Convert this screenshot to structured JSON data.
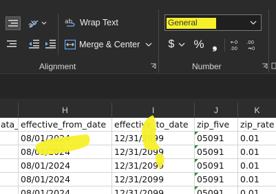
{
  "ribbon": {
    "wrap_text_label": "Wrap Text",
    "merge_center_label": "Merge & Center",
    "number_format_value": "General",
    "currency_symbol": "$",
    "percent_symbol": "%",
    "comma_symbol": "❟",
    "alignment_group_label": "Alignment",
    "number_group_label": "Number",
    "highlight_color": "#f6f02a"
  },
  "columns": [
    {
      "letter": "",
      "header": "ata_"
    },
    {
      "letter": "H",
      "header": "effective_from_date"
    },
    {
      "letter": "I",
      "header": "effective_to_date"
    },
    {
      "letter": "J",
      "header": "zip_five"
    },
    {
      "letter": "K",
      "header": "zip_rate"
    }
  ],
  "rows": [
    {
      "from": "08/01/2024",
      "to": "12/31/2099",
      "zip": "05091",
      "rate": "0.01"
    },
    {
      "from": "08/01/2024",
      "to": "12/31/2099",
      "zip": "05091",
      "rate": "0.01"
    },
    {
      "from": "08/01/2024",
      "to": "12/31/2099",
      "zip": "05091",
      "rate": "0.01"
    },
    {
      "from": "08/01/2024",
      "to": "12/31/2099",
      "zip": "05091",
      "rate": "0.01"
    },
    {
      "from": "08/01/2024",
      "to": "12/31/2099",
      "zip": "05091",
      "rate": "0.01"
    }
  ]
}
